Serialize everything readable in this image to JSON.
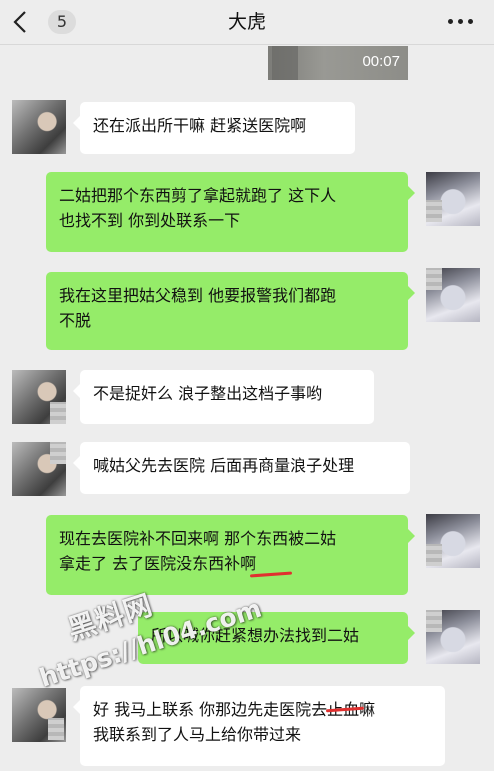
{
  "header": {
    "back_count": "5",
    "title": "大虎"
  },
  "video": {
    "duration": "00:07"
  },
  "messages": [
    {
      "side": "left",
      "text": "还在派出所干嘛 赶紧送医院啊"
    },
    {
      "side": "right",
      "text": "二姑把那个东西剪了拿起就跑了 这下人\n也找不到 你到处联系一下"
    },
    {
      "side": "right",
      "text": "我在这里把姑父稳到 他要报警我们都跑\n不脱"
    },
    {
      "side": "left",
      "text": "不是捉奸么 浪子整出这档子事哟"
    },
    {
      "side": "left",
      "text": "喊姑父先去医院 后面再商量浪子处理"
    },
    {
      "side": "right",
      "text": "现在去医院补不回来啊 那个东西被二姑\n拿走了 去了医院没东西补啊"
    },
    {
      "side": "right",
      "text": "所以喊你赶紧想办法找到二姑"
    },
    {
      "side": "left",
      "text": "好 我马上联系 你那边先走医院去止血嘛\n我联系到了人马上给你带过来"
    }
  ],
  "watermark": {
    "name": "黑料网",
    "url": "https://hl04.com"
  },
  "colors": {
    "background": "#ededed",
    "bubble_self": "#95ec69",
    "bubble_other": "#ffffff",
    "strike": "#e0302f"
  }
}
